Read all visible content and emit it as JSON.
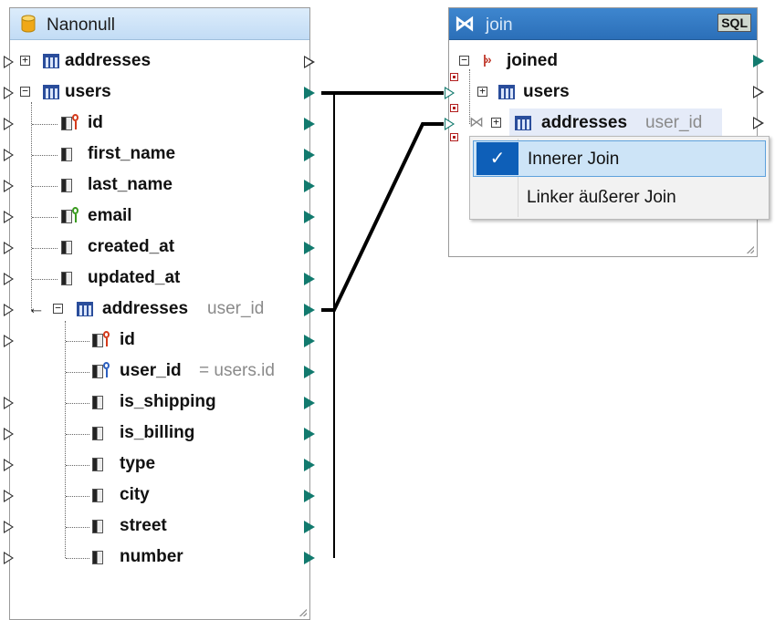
{
  "source": {
    "title": "Nanonull",
    "tables": [
      {
        "label": "addresses",
        "expander": "+"
      },
      {
        "label": "users",
        "expander": "−"
      }
    ],
    "users_fields": [
      {
        "label": "id",
        "key": "red"
      },
      {
        "label": "first_name",
        "key": ""
      },
      {
        "label": "last_name",
        "key": ""
      },
      {
        "label": "email",
        "key": "green"
      },
      {
        "label": "created_at",
        "key": ""
      },
      {
        "label": "updated_at",
        "key": ""
      }
    ],
    "nested": {
      "arrow": "←",
      "expander": "−",
      "label": "addresses",
      "hint": "user_id"
    },
    "nested_fields": [
      {
        "label": "id",
        "key": "red",
        "hint": ""
      },
      {
        "label": "user_id",
        "key": "blue",
        "hint": "= users.id"
      },
      {
        "label": "is_shipping",
        "key": "",
        "hint": ""
      },
      {
        "label": "is_billing",
        "key": "",
        "hint": ""
      },
      {
        "label": "type",
        "key": "",
        "hint": ""
      },
      {
        "label": "city",
        "key": "",
        "hint": ""
      },
      {
        "label": "street",
        "key": "",
        "hint": ""
      },
      {
        "label": "number",
        "key": "",
        "hint": ""
      }
    ]
  },
  "join": {
    "title": "join",
    "sql_badge": "SQL",
    "joined_label": "joined",
    "users_label": "users",
    "addresses_label": "addresses",
    "addresses_hint": "user_id",
    "expander_minus": "−",
    "expander_plus": "+",
    "join_symbol": "⋈"
  },
  "context_menu": {
    "items": [
      {
        "label": "Innerer Join",
        "checked": true
      },
      {
        "label": "Linker äußerer Join",
        "checked": false
      }
    ],
    "check_glyph": "✓"
  },
  "colors": {
    "accent": "#0e5fb8",
    "port_mapped": "#127a6e",
    "connector": "#000000",
    "db_icon": "#f0a818"
  }
}
